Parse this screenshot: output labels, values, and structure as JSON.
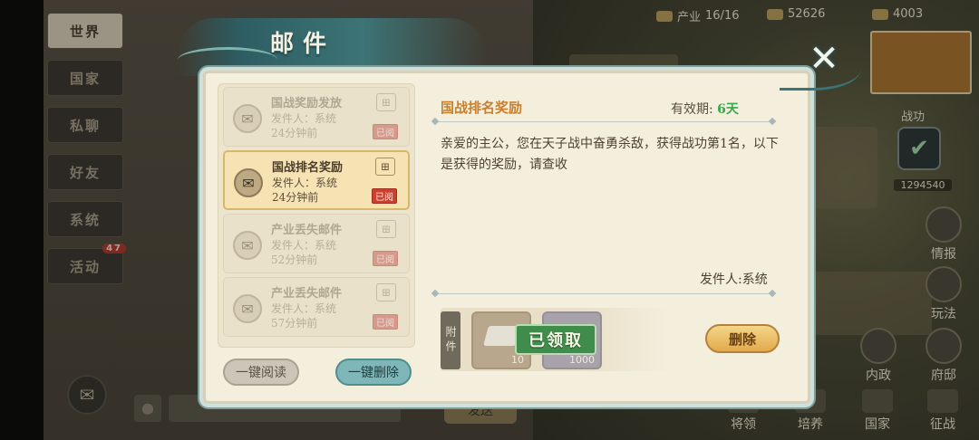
{
  "left_tabs": {
    "world": "世界",
    "country": "国家",
    "private": "私聊",
    "friends": "好友",
    "system": "系统",
    "activity": "活动",
    "activity_badge": "47"
  },
  "chat": {
    "send_label": "发送"
  },
  "top_bar": {
    "industry_label": "产业",
    "industry_value": "16/16",
    "resource1": "52626",
    "resource2": "4003"
  },
  "right_panel": {
    "battle_label": "战功",
    "battle_value": "1294540",
    "intel": "情报",
    "play": "玩法",
    "internal": "内政",
    "mansion": "府邸"
  },
  "bottom_bar": {
    "generals": "将领",
    "cultivate": "培养",
    "country": "国家",
    "campaign": "征战"
  },
  "mail_dialog": {
    "title": "邮件",
    "list": [
      {
        "title": "国战奖励发放",
        "sender": "发件人：系统",
        "time": "24分钟前",
        "tag": "已阅",
        "selected": false
      },
      {
        "title": "国战排名奖励",
        "sender": "发件人：系统",
        "time": "24分钟前",
        "tag": "已阅",
        "selected": true
      },
      {
        "title": "产业丢失邮件",
        "sender": "发件人：系统",
        "time": "52分钟前",
        "tag": "已阅",
        "selected": false
      },
      {
        "title": "产业丢失邮件",
        "sender": "发件人：系统",
        "time": "57分钟前",
        "tag": "已阅",
        "selected": false
      }
    ],
    "read_all_label": "一键阅读",
    "delete_all_label": "一键删除",
    "detail": {
      "title": "国战排名奖励",
      "validity_label": "有效期:",
      "validity_value": "6天",
      "body": "亲爱的主公，您在天子战中奋勇杀敌，获得战功第1名，以下是获得的奖励，请查收",
      "sender": "发件人:系统",
      "attachment_label": "附件",
      "attachments": [
        {
          "icon": "silver-ingot-icon",
          "qty": "10"
        },
        {
          "icon": "item-icon",
          "qty": "1000"
        }
      ],
      "claimed_label": "已领取",
      "delete_label": "删除"
    }
  },
  "colors": {
    "accent_orange": "#c9802d",
    "validity_green": "#3aa64b",
    "claimed_green": "#3f8c4c",
    "delete_gold": "#e3aa4b",
    "delete_all_teal": "#7fb6b7"
  }
}
